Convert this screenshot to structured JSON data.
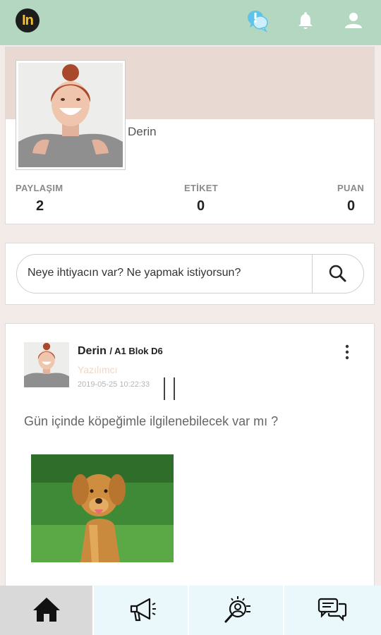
{
  "header": {
    "logo_text": "In",
    "icons": [
      "chat-alert-icon",
      "bell-icon",
      "user-icon"
    ],
    "accent": "#b3d7c0"
  },
  "profile": {
    "name": "Derin",
    "stats": [
      {
        "label": "PAYLAŞIM",
        "value": "2"
      },
      {
        "label": "ETİKET",
        "value": "0"
      },
      {
        "label": "PUAN",
        "value": "0"
      }
    ]
  },
  "search": {
    "placeholder": "Neye ihtiyacın var? Ne yapmak istiyorsun?"
  },
  "post": {
    "author": "Derin",
    "location": "/ A1 Blok D6",
    "role": "Yazılımcı",
    "timestamp": "2019-05-25 10:22:33",
    "text": "Gün içinde köpeğimle ilgilenebilecek var mı ?"
  },
  "bottom_nav": [
    {
      "icon": "home-icon",
      "active": true
    },
    {
      "icon": "megaphone-icon",
      "active": false
    },
    {
      "icon": "people-search-icon",
      "active": false
    },
    {
      "icon": "chat-bubbles-icon",
      "active": false
    }
  ]
}
